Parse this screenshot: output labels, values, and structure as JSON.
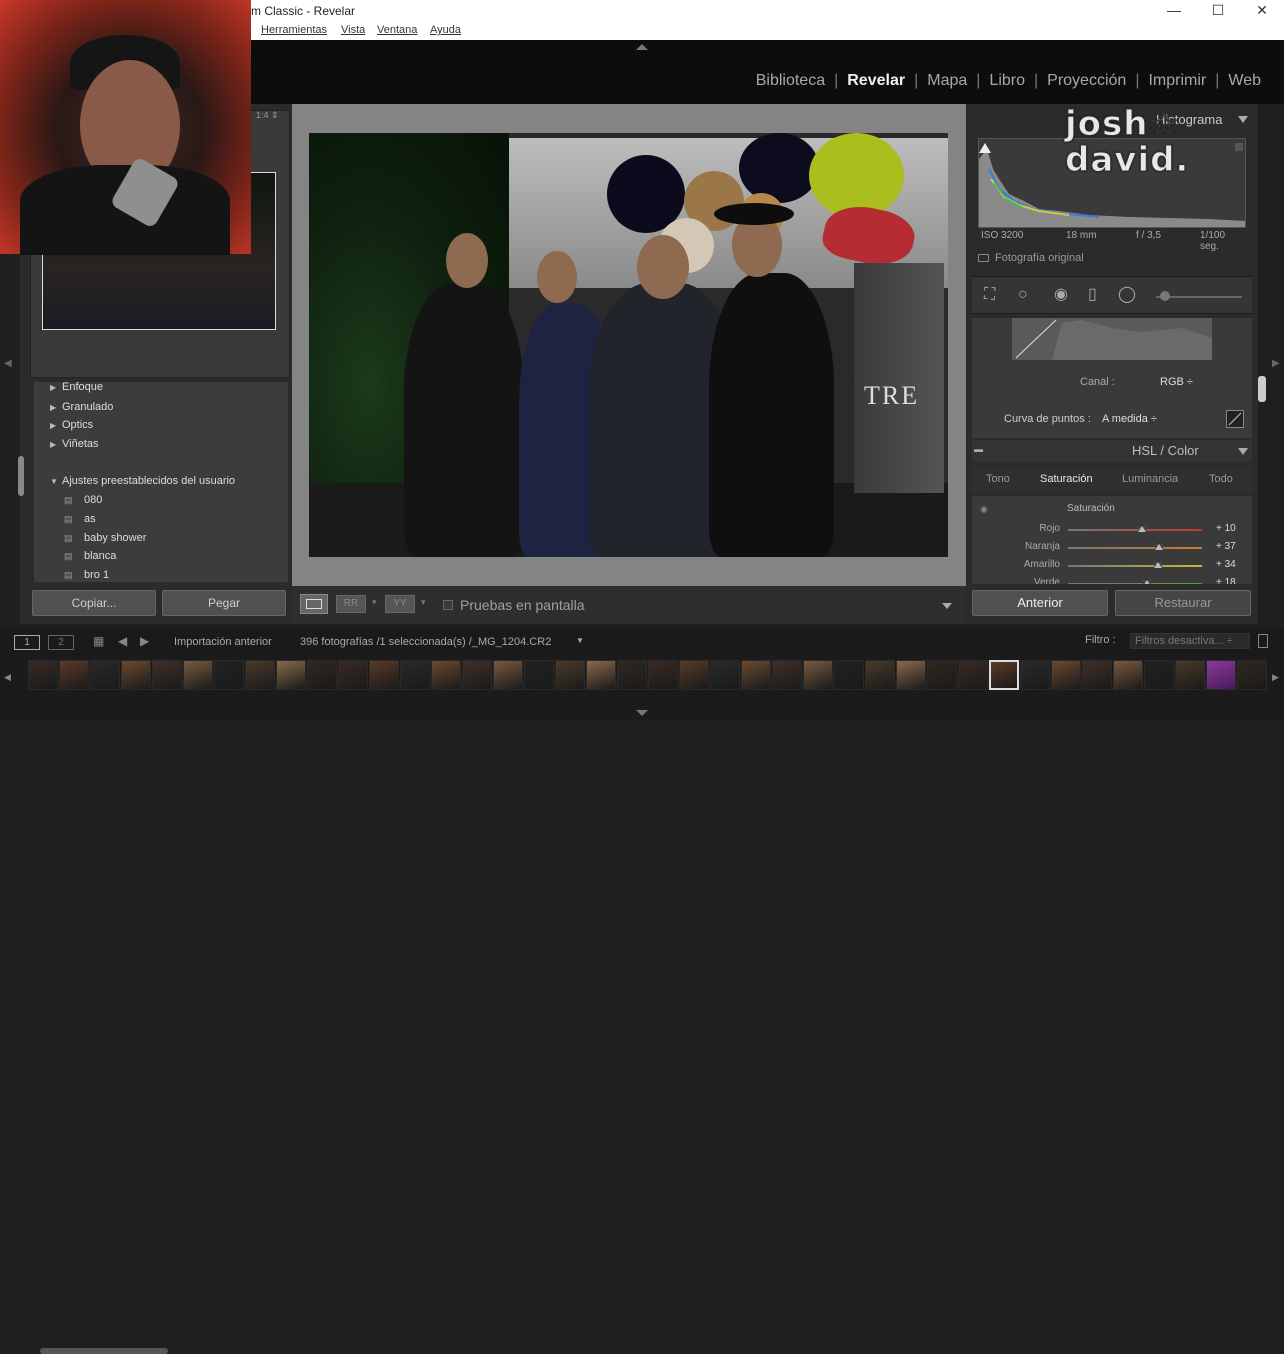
{
  "window": {
    "title": "m Classic - Revelar",
    "controls": [
      "—",
      "☐",
      "✕"
    ]
  },
  "menu": [
    "Herramientas",
    "Vista",
    "Ventana",
    "Ayuda"
  ],
  "modules": [
    "Biblioteca",
    "Revelar",
    "Mapa",
    "Libro",
    "Proyección",
    "Imprimir",
    "Web"
  ],
  "active_module": "Revelar",
  "navigator": {
    "zoom": "1:4 ⇕"
  },
  "left_panel": {
    "sections": [
      "Enfoque",
      "Granulado",
      "Optics",
      "Viñetas"
    ],
    "presets_header": "Ajustes preestablecidos del usuario",
    "presets": [
      "080",
      "as",
      "baby shower",
      "blanca",
      "bro 1"
    ],
    "copy_label": "Copiar...",
    "paste_label": "Pegar"
  },
  "histogram": {
    "title": "Histograma",
    "iso": "ISO 3200",
    "focal": "18 mm",
    "aperture": "f / 3,5",
    "shutter": "1/100 seg.",
    "original_label": "Fotografía original"
  },
  "watermark": {
    "line1": "josh☆",
    "line2": "david."
  },
  "photo": {
    "sign_text": "TRE"
  },
  "tone_curve": {
    "canal_label": "Canal :",
    "canal_value": "RGB ÷",
    "curva_label": "Curva de puntos :",
    "curva_value": "A medida ÷"
  },
  "hsl": {
    "title": "HSL / Color",
    "tabs": [
      "Tono",
      "Saturación",
      "Luminancia",
      "Todo"
    ],
    "active_tab": "Saturación",
    "section": "Saturación",
    "sliders": [
      {
        "label": "Rojo",
        "value": "+ 10",
        "level": 0.55,
        "color": "#c0392b"
      },
      {
        "label": "Naranja",
        "value": "+ 37",
        "level": 0.68,
        "color": "#d07a2a"
      },
      {
        "label": "Amarillo",
        "value": "+ 34",
        "level": 0.67,
        "color": "#c9b73a"
      },
      {
        "label": "Verde",
        "value": "+ 18",
        "level": 0.59,
        "color": "#5aa03a"
      }
    ]
  },
  "right_buttons": {
    "previous": "Anterior",
    "reset": "Restaurar"
  },
  "toolbar": {
    "proof_label": "Pruebas en pantalla"
  },
  "filmbar": {
    "page1": "1",
    "page2": "2",
    "source": "Importación anterior",
    "count": "396 fotografías /1 seleccionada(s) /_MG_1204.CR2",
    "filter_label": "Filtro :",
    "filter_value": "Filtros desactiva... ÷"
  }
}
